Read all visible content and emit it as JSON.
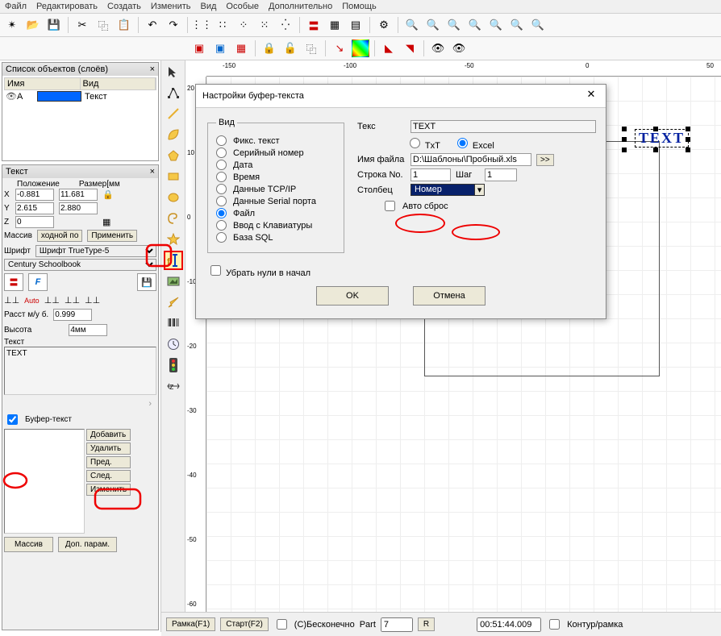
{
  "menu": [
    "Файл",
    "Редактировать",
    "Создать",
    "Изменить",
    "Вид",
    "Особые",
    "Дополнительно",
    "Помощь"
  ],
  "panels": {
    "objects_title": "Список объектов (слоёв)",
    "col_name": "Имя",
    "col_type": "Вид",
    "obj_name": "A",
    "obj_type": "Текст",
    "text_title": "Текст",
    "pos_label": "Положение",
    "size_label": "Размер[мм",
    "x": "-0.881",
    "x_size": "11.681",
    "y": "2.615",
    "y_size": "2.880",
    "z": "0",
    "massive": "Массив",
    "inp": "ходной по",
    "apply": "Применить",
    "font_label": "Шрифт",
    "font_type": "Шрифт TrueType-5",
    "font_name": "Century Schoolbook",
    "auto": "Auto",
    "dist": "Расст м/у б.",
    "dist_val": "0.999",
    "height": "Высота",
    "height_val": "4мм",
    "text_label": "Текст",
    "text_value": "TEXT",
    "buffer_chk": "Буфер-текст",
    "add": "Добавить",
    "del": "Удалить",
    "prev": "Пред.",
    "next": "След.",
    "change": "Изменить",
    "massive_btn": "Массив",
    "extra": "Доп. парам."
  },
  "dialog": {
    "title": "Настройки буфер-текста",
    "group_view": "Вид",
    "r_fixed": "Фикс. текст",
    "r_serial": "Серийный номер",
    "r_date": "Дата",
    "r_time": "Время",
    "r_tcp": "Данные TCP/IP",
    "r_serialport": "Данные Serial порта",
    "r_file": "Файл",
    "r_kbd": "Ввод с Клавиатуры",
    "r_sql": "База SQL",
    "text_label": "Текс",
    "text_val": "TEXT",
    "txt": "TxT",
    "excel": "Excel",
    "filename": "Имя файла",
    "filename_val": "D:\\Шаблоны\\Пробный.xls",
    "browse": ">>",
    "row": "Строка No.",
    "row_val": "1",
    "step": "Шаг",
    "step_val": "1",
    "col": "Столбец",
    "col_val": "Номер",
    "auto_reset": "Авто сброс",
    "trim_zeros": "Убрать нули в начал",
    "ok": "OK",
    "cancel": "Отмена"
  },
  "canvas": {
    "text_obj": "TEXT"
  },
  "status": {
    "frame": "Рамка(F1)",
    "start": "Старт(F2)",
    "inf": "(C)Бесконечно",
    "part": "Part",
    "part_val": "7",
    "r": "R",
    "time": "00:51:44.009",
    "contour": "Контур/рамка"
  },
  "ruler_h": [
    "-150",
    "-100",
    "-50",
    "0",
    "50"
  ],
  "ruler_v": [
    "20",
    "10",
    "0",
    "-10",
    "-20",
    "-30",
    "-40",
    "-50",
    "-60"
  ]
}
